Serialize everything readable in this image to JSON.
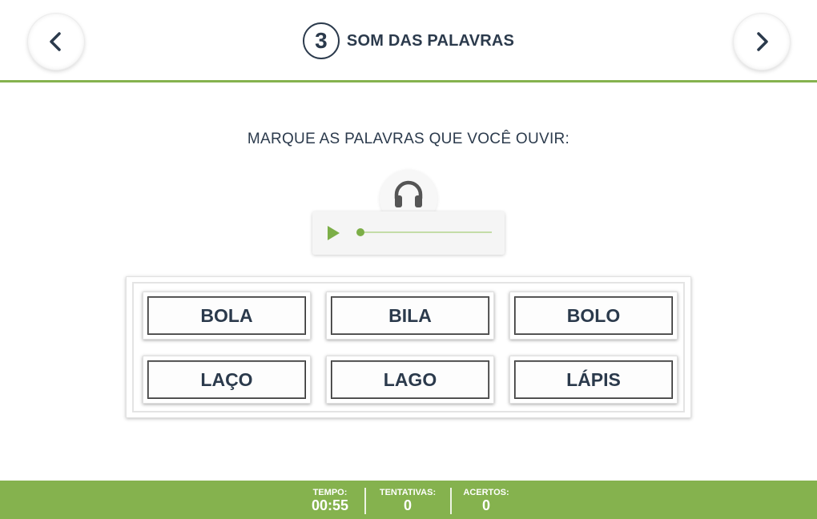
{
  "header": {
    "step_number": "3",
    "title": "SOM DAS PALAVRAS",
    "prev_icon": "chevron-left-icon",
    "next_icon": "chevron-right-icon"
  },
  "instruction": "MARQUE AS PALAVRAS QUE VOCÊ OUVIR:",
  "audio": {
    "icon": "headphones-icon",
    "play_icon": "play-icon",
    "progress": 0
  },
  "words": [
    "BOLA",
    "BILA",
    "BOLO",
    "LAÇO",
    "LAGO",
    "LÁPIS"
  ],
  "footer": {
    "time_label": "TEMPO:",
    "time_value": "00:55",
    "tries_label": "TENTATIVAS:",
    "tries_value": "0",
    "hits_label": "ACERTOS:",
    "hits_value": "0"
  },
  "colors": {
    "accent": "#85b24e",
    "text": "#2b3a4c"
  }
}
